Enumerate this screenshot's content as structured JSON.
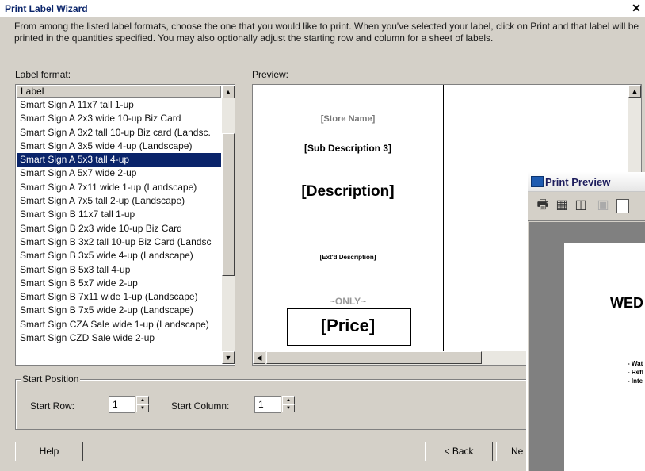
{
  "window": {
    "title": "Print Label Wizard",
    "close_glyph": "✕"
  },
  "instructions": "From among the listed label formats, choose the one that you would like to print.  When you've selected your label, click on Print and that label will be printed in the quantities specified.  You may also optionally adjust the starting row and column for a sheet of labels.",
  "label_format": {
    "heading": "Label format:",
    "column_header": "Label",
    "selected_index": 4,
    "items": [
      "Smart Sign A 11x7 tall 1-up",
      "Smart Sign A 2x3 wide 10-up Biz Card",
      "Smart Sign A 3x2 tall 10-up Biz card (Landsc.",
      "Smart Sign A 3x5 wide 4-up (Landscape)",
      "Smart Sign A 5x3 tall 4-up",
      "Smart Sign A 5x7 wide 2-up",
      "Smart Sign A 7x11 wide 1-up (Landscape)",
      "Smart Sign A 7x5 tall 2-up (Landscape)",
      "Smart Sign B 11x7 tall 1-up",
      "Smart Sign B 2x3 wide 10-up Biz Card",
      "Smart Sign B 3x2 tall 10-up Biz Card (Landsc",
      "Smart Sign B 3x5 wide 4-up (Landscape)",
      "Smart Sign B 5x3 tall 4-up",
      "Smart Sign B 5x7 wide 2-up",
      "Smart Sign B 7x11 wide 1-up (Landscape)",
      "Smart Sign B 7x5 wide 2-up (Landscape)",
      "Smart Sign CZA Sale wide 1-up (Landscape)",
      "Smart Sign CZD Sale wide 2-up"
    ]
  },
  "preview": {
    "heading": "Preview:",
    "store_name": "[Store Name]",
    "sub_description": "[Sub Description 3]",
    "description": "[Description]",
    "extd_description": "[Ext'd Description]",
    "only": "~ONLY~",
    "price": "[Price]"
  },
  "start_position": {
    "group_label": "Start Position",
    "row_label": "Start Row:",
    "row_value": "1",
    "column_label": "Start Column:",
    "column_value": "1"
  },
  "buttons": {
    "help": "Help",
    "back": "< Back",
    "next_partial": "Ne"
  },
  "print_preview": {
    "title": "Print Preview",
    "page_heading": "WED",
    "bullets": [
      "- Wat",
      "- Refl",
      "- Inte"
    ],
    "icon_color": "#1e5bb0"
  },
  "colors": {
    "selection": "#0a246a",
    "title_text": "#0a246a",
    "face": "#d4d0c8"
  }
}
